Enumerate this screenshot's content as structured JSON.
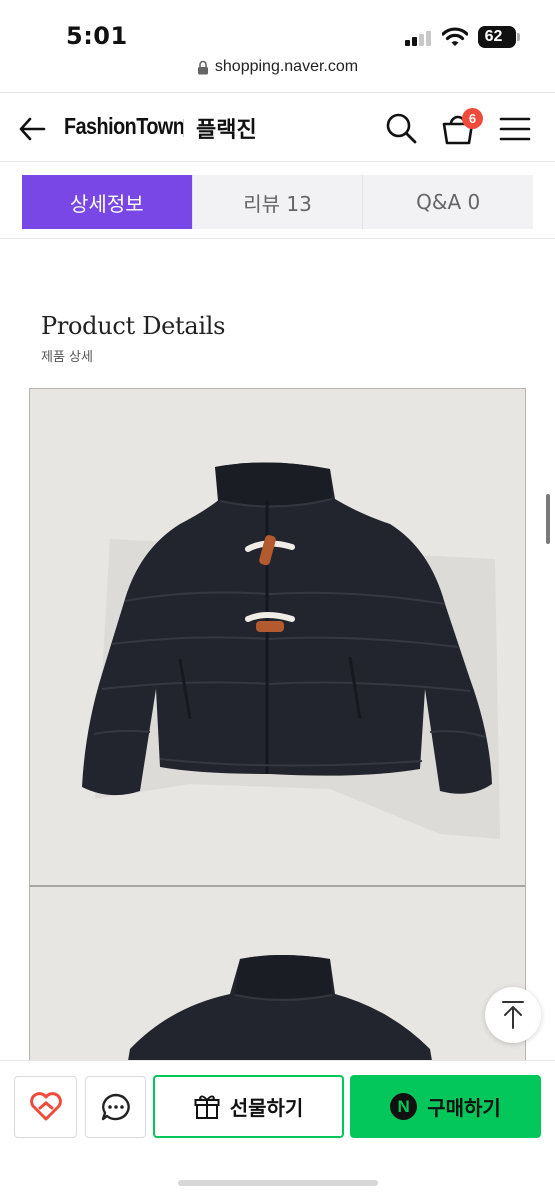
{
  "status_bar": {
    "time": "5:01",
    "battery": "62"
  },
  "browser": {
    "url": "shopping.naver.com"
  },
  "header": {
    "brand": "FashionTown",
    "store_name": "플랙진",
    "cart_count": "6",
    "icons": [
      "back-arrow-icon",
      "search-icon",
      "cart-icon",
      "menu-icon"
    ]
  },
  "tabs": [
    {
      "label": "상세정보",
      "active": true
    },
    {
      "label": "리뷰 13",
      "active": false
    },
    {
      "label": "Q&A 0",
      "active": false
    }
  ],
  "details": {
    "title": "Product Details",
    "subtitle": "제품 상세"
  },
  "bottom_bar": {
    "gift_label": "선물하기",
    "buy_label": "구매하기",
    "npay_letter": "N"
  },
  "colors": {
    "active_tab": "#7847e5",
    "naver_green": "#03c75a",
    "badge_red": "#ef4b3c",
    "zzim_red": "#ef4b3c"
  }
}
